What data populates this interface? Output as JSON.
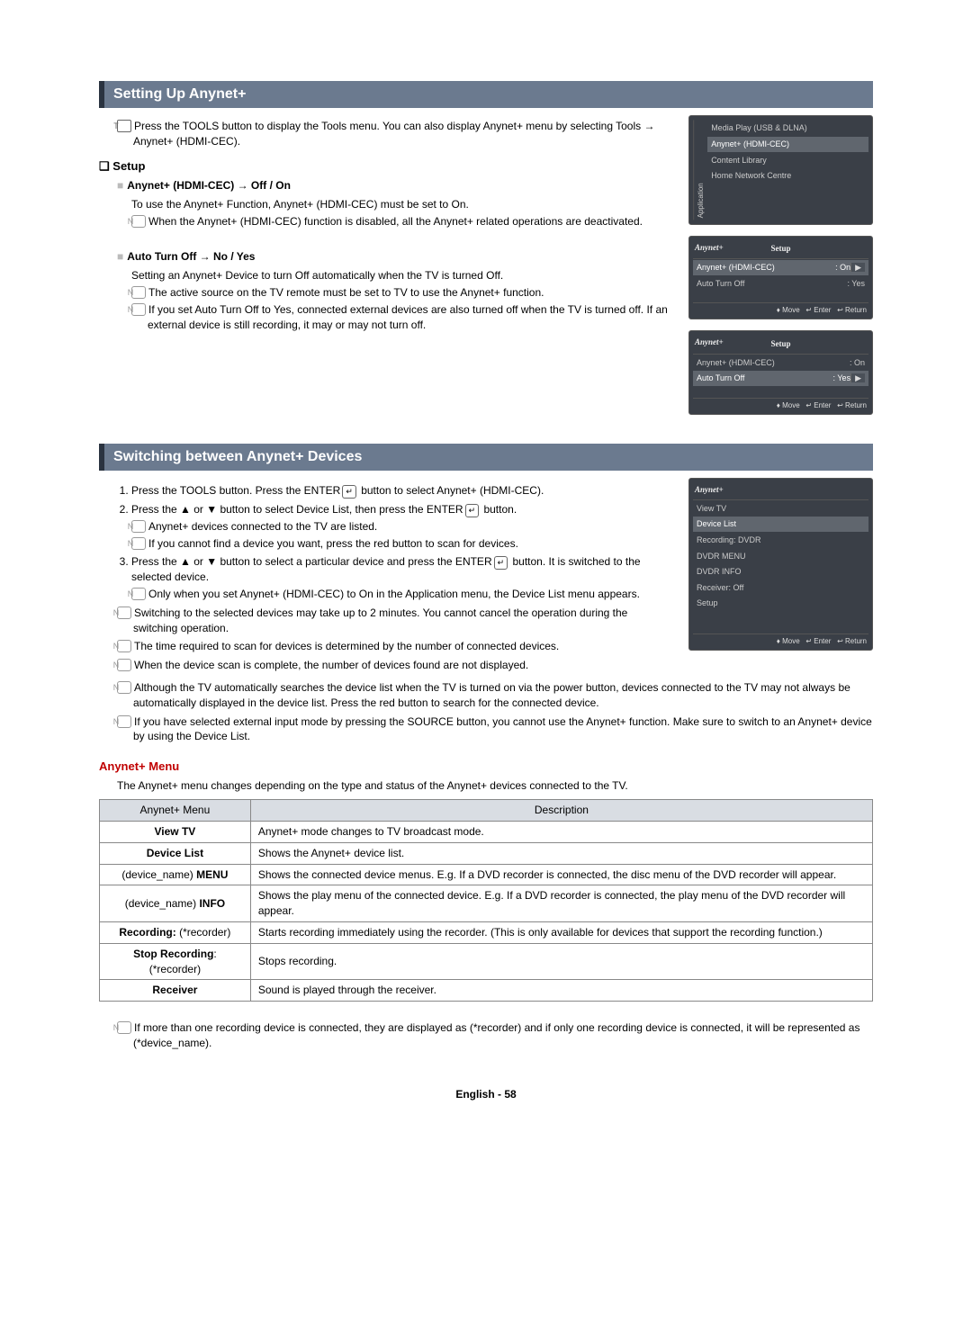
{
  "sections": {
    "setup_title": "Setting Up Anynet+",
    "switch_title": "Switching between Anynet+ Devices"
  },
  "setup": {
    "intro": "Press the TOOLS button to display the Tools menu. You can also display Anynet+ menu by selecting Tools → Anynet+ (HDMI-CEC).",
    "setup_heading": "Setup",
    "hdmi_title": "Anynet+ (HDMI-CEC) → Off / On",
    "hdmi_line1": "To use the Anynet+ Function, Anynet+ (HDMI-CEC) must be set to On.",
    "hdmi_note": "When the Anynet+ (HDMI-CEC) function is disabled, all the Anynet+ related operations are deactivated.",
    "auto_title": "Auto Turn Off → No / Yes",
    "auto_line1": "Setting an Anynet+ Device to turn Off automatically when the TV is turned Off.",
    "auto_note1": "The active source on the TV remote must be set to TV to use the Anynet+ function.",
    "auto_note2": "If you set Auto Turn Off to Yes, connected external devices are also turned off when the TV is turned off. If an external device is still recording, it may or may not turn off."
  },
  "switching": {
    "step1": "Press the TOOLS button. Press the ENTER",
    "step1b": " button to select Anynet+ (HDMI-CEC).",
    "step2": "Press the ▲ or ▼ button to select Device List, then press the ENTER",
    "step2b": " button.",
    "step2_n1": "Anynet+ devices connected to the TV are listed.",
    "step2_n2": "If you cannot find a device you want, press the red button to scan for devices.",
    "step3": "Press the ▲ or ▼ button to select a particular device and press the ENTER",
    "step3b": " button. It is switched to the selected device.",
    "step3_n1": "Only when you set Anynet+ (HDMI-CEC) to On in the Application menu, the Device List menu appears.",
    "bottom_n1": "Switching to the selected devices may take up to 2 minutes. You cannot cancel the operation during the switching operation.",
    "bottom_n2": "The time required to scan for devices is determined by the number of connected devices.",
    "bottom_n3": "When the device scan is complete, the number of devices found are not displayed.",
    "bottom_n4": "Although the TV automatically searches the device list when the TV is turned on via the power button, devices connected to the TV may not always be automatically displayed in the device list. Press the red button to search for the connected device.",
    "bottom_n5": "If you have selected external input mode by pressing the SOURCE button, you cannot use the Anynet+ function. Make sure to switch to an Anynet+ device by using the Device List."
  },
  "menu": {
    "heading": "Anynet+ Menu",
    "intro": "The Anynet+ menu changes depending on the type and status of the Anynet+ devices connected to the TV.",
    "col1": "Anynet+ Menu",
    "col2": "Description",
    "rows": [
      {
        "a": "View TV",
        "b": "Anynet+ mode changes to TV broadcast mode."
      },
      {
        "a": "Device List",
        "b": "Shows the Anynet+ device list."
      },
      {
        "a": "(device_name) MENU",
        "b": "Shows the connected device menus. E.g. If a DVD recorder is connected, the disc menu of the DVD recorder will appear."
      },
      {
        "a": "(device_name) INFO",
        "b": "Shows the play menu of the connected device. E.g. If a DVD recorder is connected, the play menu of the DVD recorder will appear."
      },
      {
        "a": "Recording: (*recorder)",
        "b": "Starts recording immediately using the recorder. (This is only available for devices that support the recording function.)"
      },
      {
        "a": "Stop Recording: (*recorder)",
        "b": "Stops recording."
      },
      {
        "a": "Receiver",
        "b": "Sound is played through the receiver."
      }
    ],
    "foot_note": "If more than one recording device is connected, they are displayed as (*recorder) and if only one recording device is connected, it will be represented as (*device_name)."
  },
  "osd": {
    "app_menu": {
      "items": [
        "Media Play (USB & DLNA)",
        "Anynet+ (HDMI-CEC)",
        "Content Library",
        "Home Network Centre"
      ],
      "side": "Application"
    },
    "setup1": {
      "title": "Setup",
      "brand": "Anynet+",
      "row1a": "Anynet+ (HDMI-CEC)",
      "row1b": ": On",
      "row2a": "Auto Turn Off",
      "row2b": ": Yes",
      "bar": "Move    Enter    Return"
    },
    "setup2": {
      "title": "Setup",
      "brand": "Anynet+",
      "row1a": "Anynet+ (HDMI-CEC)",
      "row1b": ": On",
      "row2a": "Auto Turn Off",
      "row2b": ": Yes",
      "bar": "Move    Enter    Return"
    },
    "devlist": {
      "brand": "Anynet+",
      "items": [
        "View TV",
        "Device List",
        "Recording: DVDR",
        "DVDR MENU",
        "DVDR INFO",
        "Receiver: Off",
        "Setup"
      ],
      "bar": "Move    Enter    Return"
    }
  },
  "footer": "English - 58",
  "icons": {
    "enter": "↵",
    "move": "♦",
    "return": "↩"
  }
}
